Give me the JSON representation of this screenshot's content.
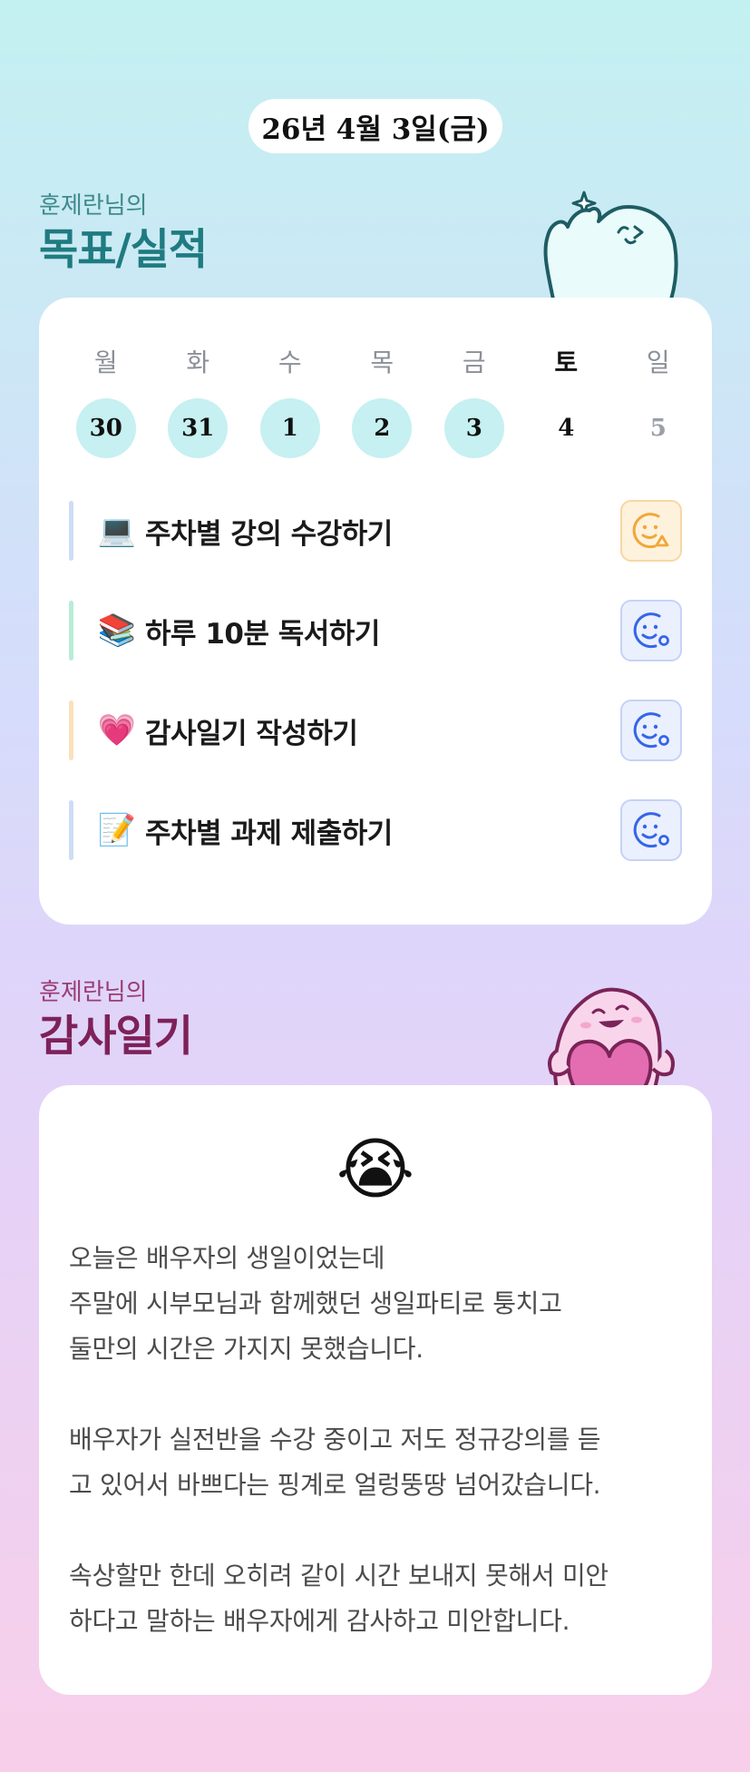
{
  "header": {
    "date": "26년 4월 3일(금)"
  },
  "goals_section": {
    "subtitle": "훈제란님의",
    "title": "목표/실적",
    "weekdays": [
      "월",
      "화",
      "수",
      "목",
      "금",
      "토",
      "일"
    ],
    "days": [
      {
        "num": "30",
        "state": "done"
      },
      {
        "num": "31",
        "state": "done"
      },
      {
        "num": "1",
        "state": "done"
      },
      {
        "num": "2",
        "state": "done"
      },
      {
        "num": "3",
        "state": "done"
      },
      {
        "num": "4",
        "state": "today"
      },
      {
        "num": "5",
        "state": "future"
      }
    ],
    "goals": [
      {
        "emoji": "💻",
        "text": "주차별 강의 수강하기",
        "bar_color": "#cfdcf6",
        "status": "warning-face-icon"
      },
      {
        "emoji": "📚",
        "text": "하루 10분 독서하기",
        "bar_color": "#b8ecd7",
        "status": "smile-face-icon"
      },
      {
        "emoji": "💗",
        "text": "감사일기 작성하기",
        "bar_color": "#fbe0bc",
        "status": "smile-face-icon"
      },
      {
        "emoji": "📝",
        "text": "주차별 과제 제출하기",
        "bar_color": "#cfdcf6",
        "status": "smile-face-icon"
      }
    ]
  },
  "diary_section": {
    "subtitle": "훈제란님의",
    "title": "감사일기",
    "mood_emoji": "😭",
    "lines": [
      "오늘은 배우자의 생일이었는데",
      "주말에 시부모님과 함께했던 생일파티로 퉁치고",
      "둘만의 시간은 가지지 못했습니다.",
      "",
      "배우자가 실전반을 수강 중이고 저도 정규강의를 듣",
      "고 있어서 바쁘다는 핑계로 얼렁뚱땅 넘어갔습니다.",
      "",
      "속상할만 한데 오히려 같이 시간 보내지 못해서 미안",
      "하다고 말하는 배우자에게 감사하고 미안합니다."
    ]
  },
  "colors": {
    "done_circle": "#c6f0f1",
    "warning": "#f1a73a",
    "ok": "#3566e8"
  }
}
